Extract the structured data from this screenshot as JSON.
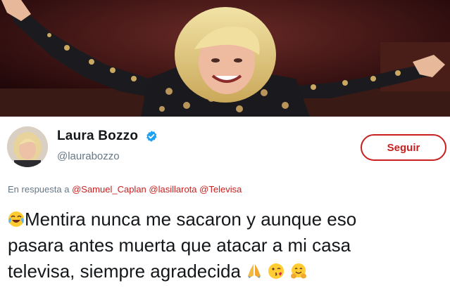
{
  "tweet": {
    "display_name": "Laura Bozzo",
    "handle": "@laurabozzo",
    "follow_label": "Seguir",
    "reply_prefix": "En respuesta a",
    "reply_mentions": [
      "@Samuel_Caplan",
      "@lasillarota",
      "@Televisa"
    ],
    "text_lines": [
      "Mentira nunca me sacaron y aunque eso",
      "pasara antes muerta que atacar a mi casa",
      "televisa, siempre agradecida"
    ],
    "emojis": {
      "leading": "face-with-tears-of-joy-icon",
      "trailing": [
        "folded-hands-icon",
        "face-blowing-kiss-icon",
        "hugging-face-icon"
      ]
    }
  },
  "colors": {
    "accent": "#c7201f",
    "verified": "#1da1f2",
    "secondary_text": "#657786",
    "primary_text": "#14171a"
  }
}
